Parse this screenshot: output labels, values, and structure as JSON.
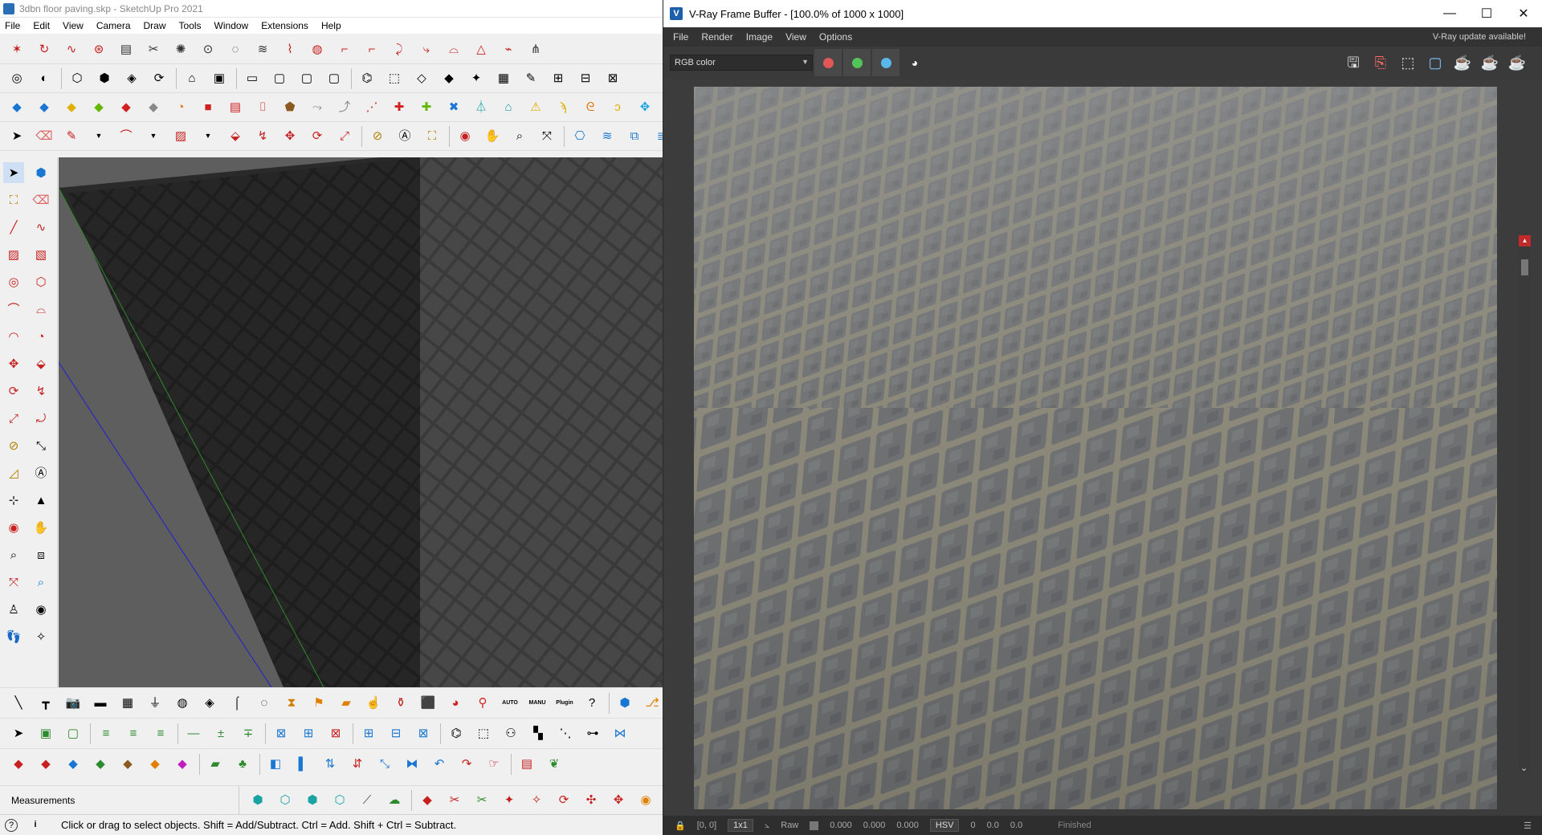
{
  "sketchup": {
    "title": "3dbn floor paving.skp - SketchUp Pro 2021",
    "menu": [
      "File",
      "Edit",
      "View",
      "Camera",
      "Draw",
      "Tools",
      "Window",
      "Extensions",
      "Help"
    ],
    "measurements_label": "Measurements",
    "status_message": "Click or drag to select objects. Shift = Add/Subtract. Ctrl = Add. Shift + Ctrl = Subtract.",
    "status_icon_info": "i",
    "plugin_labels": {
      "auto": "AUTO",
      "manu": "MANU",
      "plugin": "Plugin"
    }
  },
  "vfb": {
    "title": "V-Ray Frame Buffer - [100.0% of 1000 x 1000]",
    "menu": [
      "File",
      "Render",
      "Image",
      "View",
      "Options"
    ],
    "update_notice": "V-Ray update available!",
    "channel": "RGB color",
    "channel_buttons": [
      {
        "name": "red-channel",
        "color": "#e05757"
      },
      {
        "name": "green-channel",
        "color": "#52c45a"
      },
      {
        "name": "blue-channel",
        "color": "#58b8ea"
      }
    ],
    "status": {
      "coords": "[0, 0]",
      "sampling": "1x1",
      "raw_label": "Raw",
      "raw_values": [
        "0.000",
        "0.000",
        "0.000"
      ],
      "color_mode": "HSV",
      "hsv_values": [
        "0",
        "0.0",
        "0.0"
      ],
      "state": "Finished"
    }
  },
  "colors": {
    "vfb_bg": "#3c3c3c",
    "paving_stone": "#6f7173",
    "paving_joint": "#8b8878",
    "axis_blue": "#1f1fd0",
    "axis_green": "#2e8a2e"
  }
}
